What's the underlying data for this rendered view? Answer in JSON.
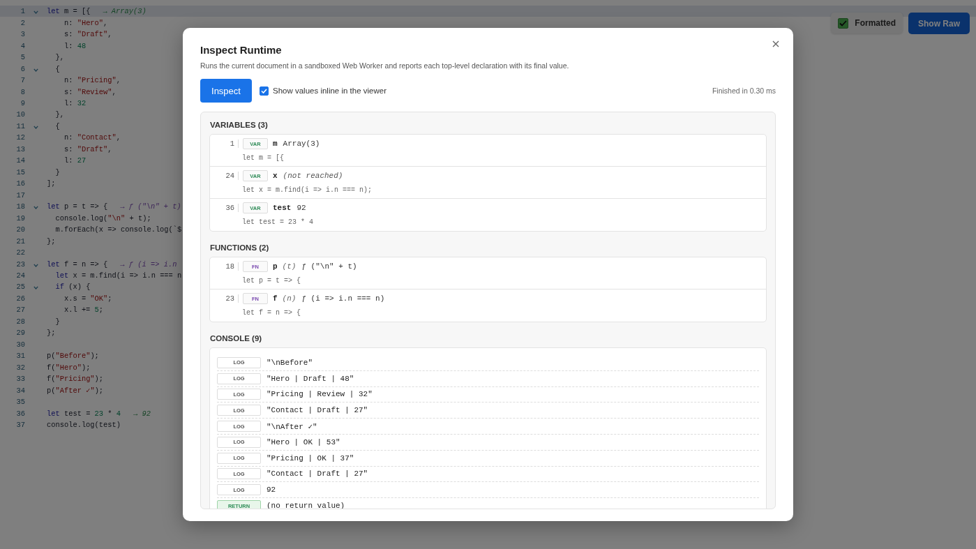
{
  "toolbar": {
    "formatted": {
      "label": "Formatted",
      "checked": true
    },
    "show_raw": {
      "label": "Show Raw"
    }
  },
  "editor": {
    "lines": [
      {
        "number": "1",
        "foldable": true,
        "current": true,
        "tokens": [
          {
            "kind": "kw",
            "text": "let"
          },
          {
            "kind": "plain",
            "text": " m = [{"
          },
          {
            "kind": "hint",
            "text": "→ Array(3)"
          }
        ]
      },
      {
        "number": "2",
        "foldable": false,
        "current": false,
        "tokens": [
          {
            "kind": "plain",
            "text": "    n: "
          },
          {
            "kind": "str",
            "text": "\"Hero\""
          },
          {
            "kind": "plain",
            "text": ","
          }
        ]
      },
      {
        "number": "3",
        "foldable": false,
        "current": false,
        "tokens": [
          {
            "kind": "plain",
            "text": "    s: "
          },
          {
            "kind": "str",
            "text": "\"Draft\""
          },
          {
            "kind": "plain",
            "text": ","
          }
        ]
      },
      {
        "number": "4",
        "foldable": false,
        "current": false,
        "tokens": [
          {
            "kind": "plain",
            "text": "    l: "
          },
          {
            "kind": "num",
            "text": "48"
          }
        ]
      },
      {
        "number": "5",
        "foldable": false,
        "current": false,
        "tokens": [
          {
            "kind": "plain",
            "text": "  },"
          }
        ]
      },
      {
        "number": "6",
        "foldable": true,
        "current": false,
        "tokens": [
          {
            "kind": "plain",
            "text": "  {"
          }
        ]
      },
      {
        "number": "7",
        "foldable": false,
        "current": false,
        "tokens": [
          {
            "kind": "plain",
            "text": "    n: "
          },
          {
            "kind": "str",
            "text": "\"Pricing\""
          },
          {
            "kind": "plain",
            "text": ","
          }
        ]
      },
      {
        "number": "8",
        "foldable": false,
        "current": false,
        "tokens": [
          {
            "kind": "plain",
            "text": "    s: "
          },
          {
            "kind": "str",
            "text": "\"Review\""
          },
          {
            "kind": "plain",
            "text": ","
          }
        ]
      },
      {
        "number": "9",
        "foldable": false,
        "current": false,
        "tokens": [
          {
            "kind": "plain",
            "text": "    l: "
          },
          {
            "kind": "num",
            "text": "32"
          }
        ]
      },
      {
        "number": "10",
        "foldable": false,
        "current": false,
        "tokens": [
          {
            "kind": "plain",
            "text": "  },"
          }
        ]
      },
      {
        "number": "11",
        "foldable": true,
        "current": false,
        "tokens": [
          {
            "kind": "plain",
            "text": "  {"
          }
        ]
      },
      {
        "number": "12",
        "foldable": false,
        "current": false,
        "tokens": [
          {
            "kind": "plain",
            "text": "    n: "
          },
          {
            "kind": "str",
            "text": "\"Contact\""
          },
          {
            "kind": "plain",
            "text": ","
          }
        ]
      },
      {
        "number": "13",
        "foldable": false,
        "current": false,
        "tokens": [
          {
            "kind": "plain",
            "text": "    s: "
          },
          {
            "kind": "str",
            "text": "\"Draft\""
          },
          {
            "kind": "plain",
            "text": ","
          }
        ]
      },
      {
        "number": "14",
        "foldable": false,
        "current": false,
        "tokens": [
          {
            "kind": "plain",
            "text": "    l: "
          },
          {
            "kind": "num",
            "text": "27"
          }
        ]
      },
      {
        "number": "15",
        "foldable": false,
        "current": false,
        "tokens": [
          {
            "kind": "plain",
            "text": "  }"
          }
        ]
      },
      {
        "number": "16",
        "foldable": false,
        "current": false,
        "tokens": [
          {
            "kind": "plain",
            "text": "];"
          }
        ]
      },
      {
        "number": "17",
        "foldable": false,
        "current": false
      },
      {
        "number": "18",
        "foldable": true,
        "current": false,
        "tokens": [
          {
            "kind": "kw",
            "text": "let"
          },
          {
            "kind": "plain",
            "text": " p = t => {"
          },
          {
            "kind": "fn_hint",
            "text": "→ ƒ (\"\\n\" + t)"
          }
        ]
      },
      {
        "number": "19",
        "foldable": false,
        "current": false,
        "tokens": [
          {
            "kind": "plain",
            "text": "  console.log("
          },
          {
            "kind": "str",
            "text": "\"\\n\""
          },
          {
            "kind": "plain",
            "text": " + t);"
          }
        ]
      },
      {
        "number": "20",
        "foldable": false,
        "current": false,
        "tokens": [
          {
            "kind": "plain",
            "text": "  m.forEach(x => console.log(`$"
          }
        ]
      },
      {
        "number": "21",
        "foldable": false,
        "current": false,
        "tokens": [
          {
            "kind": "plain",
            "text": "};"
          }
        ]
      },
      {
        "number": "22",
        "foldable": false,
        "current": false
      },
      {
        "number": "23",
        "foldable": true,
        "current": false,
        "tokens": [
          {
            "kind": "kw",
            "text": "let"
          },
          {
            "kind": "plain",
            "text": " f = n => {"
          },
          {
            "kind": "fn_hint",
            "text": "→ ƒ (i => i.n"
          }
        ]
      },
      {
        "number": "24",
        "foldable": false,
        "current": false,
        "tokens": [
          {
            "kind": "kw",
            "text": "  let"
          },
          {
            "kind": "plain",
            "text": " x = m.find(i => i.n === n"
          }
        ]
      },
      {
        "number": "25",
        "foldable": true,
        "current": false,
        "tokens": [
          {
            "kind": "kw",
            "text": "  if"
          },
          {
            "kind": "plain",
            "text": " (x) {"
          }
        ]
      },
      {
        "number": "26",
        "foldable": false,
        "current": false,
        "tokens": [
          {
            "kind": "plain",
            "text": "    x.s = "
          },
          {
            "kind": "str",
            "text": "\"OK\""
          },
          {
            "kind": "plain",
            "text": ";"
          }
        ]
      },
      {
        "number": "27",
        "foldable": false,
        "current": false,
        "tokens": [
          {
            "kind": "plain",
            "text": "    x.l += "
          },
          {
            "kind": "num",
            "text": "5"
          },
          {
            "kind": "plain",
            "text": ";"
          }
        ]
      },
      {
        "number": "28",
        "foldable": false,
        "current": false,
        "tokens": [
          {
            "kind": "plain",
            "text": "  }"
          }
        ]
      },
      {
        "number": "29",
        "foldable": false,
        "current": false,
        "tokens": [
          {
            "kind": "plain",
            "text": "};"
          }
        ]
      },
      {
        "number": "30",
        "foldable": false,
        "current": false
      },
      {
        "number": "31",
        "foldable": false,
        "current": false,
        "tokens": [
          {
            "kind": "plain",
            "text": "p("
          },
          {
            "kind": "str",
            "text": "\"Before\""
          },
          {
            "kind": "plain",
            "text": ");"
          }
        ]
      },
      {
        "number": "32",
        "foldable": false,
        "current": false,
        "tokens": [
          {
            "kind": "plain",
            "text": "f("
          },
          {
            "kind": "str",
            "text": "\"Hero\""
          },
          {
            "kind": "plain",
            "text": ");"
          }
        ]
      },
      {
        "number": "33",
        "foldable": false,
        "current": false,
        "tokens": [
          {
            "kind": "plain",
            "text": "f("
          },
          {
            "kind": "str",
            "text": "\"Pricing\""
          },
          {
            "kind": "plain",
            "text": ");"
          }
        ]
      },
      {
        "number": "34",
        "foldable": false,
        "current": false,
        "tokens": [
          {
            "kind": "plain",
            "text": "p("
          },
          {
            "kind": "str",
            "text": "\"After ✓\""
          },
          {
            "kind": "plain",
            "text": ");"
          }
        ]
      },
      {
        "number": "35",
        "foldable": false,
        "current": false
      },
      {
        "number": "36",
        "foldable": false,
        "current": false,
        "tokens": [
          {
            "kind": "kw",
            "text": "let"
          },
          {
            "kind": "plain",
            "text": " test = "
          },
          {
            "kind": "num",
            "text": "23"
          },
          {
            "kind": "plain",
            "text": " * "
          },
          {
            "kind": "num",
            "text": "4"
          },
          {
            "kind": "hint",
            "text": "→ 92"
          }
        ]
      },
      {
        "number": "37",
        "foldable": false,
        "current": false,
        "tokens": [
          {
            "kind": "plain",
            "text": "console.log(test)"
          }
        ]
      }
    ]
  },
  "dialog": {
    "title": "Inspect Runtime",
    "description": "Runs the current document in a sandboxed Web Worker and reports each top-level declaration with its final value.",
    "inspect_button": "Inspect",
    "inline_option": {
      "label": "Show values inline in the viewer",
      "checked": true
    },
    "status": "Finished in 0.30 ms",
    "sections": [
      {
        "kind": "declarations",
        "heading": "VARIABLES (3)",
        "items": [
          {
            "line": "1",
            "kind": "var",
            "tag": "VAR",
            "name": "m",
            "value": "Array(3)",
            "resolved": true,
            "source": "let m = [{"
          },
          {
            "line": "24",
            "kind": "var",
            "tag": "VAR",
            "name": "x",
            "value": "(not reached)",
            "resolved": false,
            "source": "let x = m.find(i => i.n === n);"
          },
          {
            "line": "36",
            "kind": "var",
            "tag": "VAR",
            "name": "test",
            "value": "92",
            "resolved": true,
            "source": "let test = 23 * 4"
          }
        ]
      },
      {
        "kind": "declarations",
        "heading": "FUNCTIONS (2)",
        "items": [
          {
            "line": "18",
            "kind": "fn",
            "tag": "FN",
            "name": "p",
            "params": "(t)",
            "value": "ƒ (\"\\n\" + t)",
            "resolved": true,
            "source": "let p = t => {"
          },
          {
            "line": "23",
            "kind": "fn",
            "tag": "FN",
            "name": "f",
            "params": "(n)",
            "value": "ƒ (i => i.n === n)",
            "resolved": true,
            "source": "let f = n => {"
          }
        ]
      },
      {
        "kind": "console",
        "heading": "CONSOLE (9)",
        "entries": [
          {
            "kind": "log",
            "tag": "LOG",
            "message": "\"\\nBefore\""
          },
          {
            "kind": "log",
            "tag": "LOG",
            "message": "\"Hero | Draft | 48\""
          },
          {
            "kind": "log",
            "tag": "LOG",
            "message": "\"Pricing | Review | 32\""
          },
          {
            "kind": "log",
            "tag": "LOG",
            "message": "\"Contact | Draft | 27\""
          },
          {
            "kind": "log",
            "tag": "LOG",
            "message": "\"\\nAfter ✓\""
          },
          {
            "kind": "log",
            "tag": "LOG",
            "message": "\"Hero | OK | 53\""
          },
          {
            "kind": "log",
            "tag": "LOG",
            "message": "\"Pricing | OK | 37\""
          },
          {
            "kind": "log",
            "tag": "LOG",
            "message": "\"Contact | Draft | 27\""
          },
          {
            "kind": "log",
            "tag": "LOG",
            "message": "92"
          },
          {
            "kind": "return",
            "tag": "RETURN",
            "message": "(no return value)"
          }
        ]
      }
    ]
  }
}
